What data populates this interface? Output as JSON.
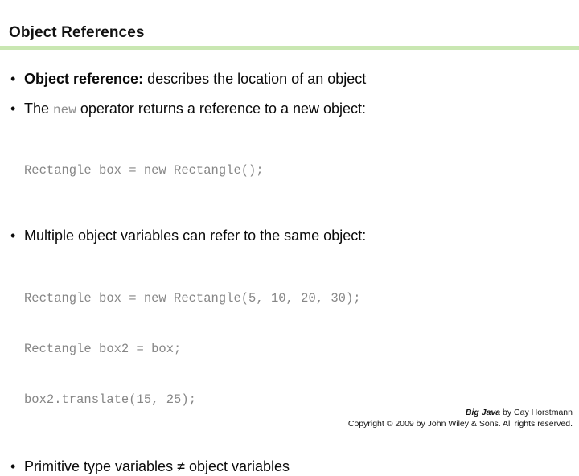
{
  "slide": {
    "title": "Object References",
    "accent_color": "#c9e7b2",
    "background_color": "#ffffff",
    "text_color": "#0a0a0a",
    "code_color": "#868686"
  },
  "bullets": [
    {
      "marker": "•",
      "lead": "Object reference",
      "lead_suffix": ":",
      "rest": " describes the location of an object"
    },
    {
      "marker": "•",
      "prefix": "The ",
      "keyword": "new",
      "rest": " operator returns a reference to a new object:"
    },
    {
      "marker": "•",
      "text": "Multiple object variables can refer to the same object:"
    },
    {
      "marker": "•",
      "text": "Primitive type variables ≠  object variables"
    }
  ],
  "code_blocks": [
    {
      "lines": [
        "Rectangle box = new Rectangle();"
      ]
    },
    {
      "lines": [
        "Rectangle box = new Rectangle(5, 10, 20, 30);",
        "Rectangle box2 = box;",
        "box2.translate(15, 25);"
      ]
    }
  ],
  "footer": {
    "book_title": "Big Java",
    "byline": " by Cay Horstmann",
    "copyright": "Copyright © 2009 by John Wiley & Sons.  All rights reserved."
  }
}
